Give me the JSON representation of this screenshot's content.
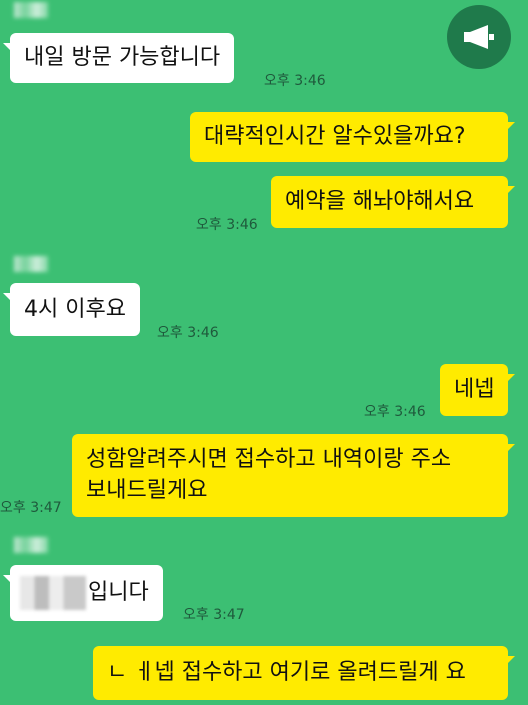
{
  "messages": [
    {
      "side": "in",
      "text": "내일 방문 가능합니다",
      "time": "오후 3:46"
    },
    {
      "side": "out",
      "text": "대략적인시간 알수있을까요?",
      "time": ""
    },
    {
      "side": "out",
      "text": "예약을 해놔야해서요",
      "time": "오후 3:46"
    },
    {
      "side": "in",
      "text": "4시 이후요",
      "time": "오후 3:46"
    },
    {
      "side": "out",
      "text": "네넵",
      "time": "오후 3:46"
    },
    {
      "side": "out",
      "line1": "성함알려주시면 접수하고 내역이랑 주소",
      "line2": "보내드릴게요",
      "time": "오후 3:47"
    },
    {
      "side": "in",
      "text": "입니다",
      "name_redacted": true,
      "time": "오후 3:47"
    },
    {
      "side": "out",
      "text": "ㄴ ㅔ넵 접수하고 여기로 올려드릴게 요",
      "time": ""
    }
  ],
  "icons": {
    "announcement": "megaphone-icon"
  },
  "colors": {
    "background": "#3cbf73",
    "incoming": "#ffffff",
    "outgoing": "#ffeb00"
  }
}
